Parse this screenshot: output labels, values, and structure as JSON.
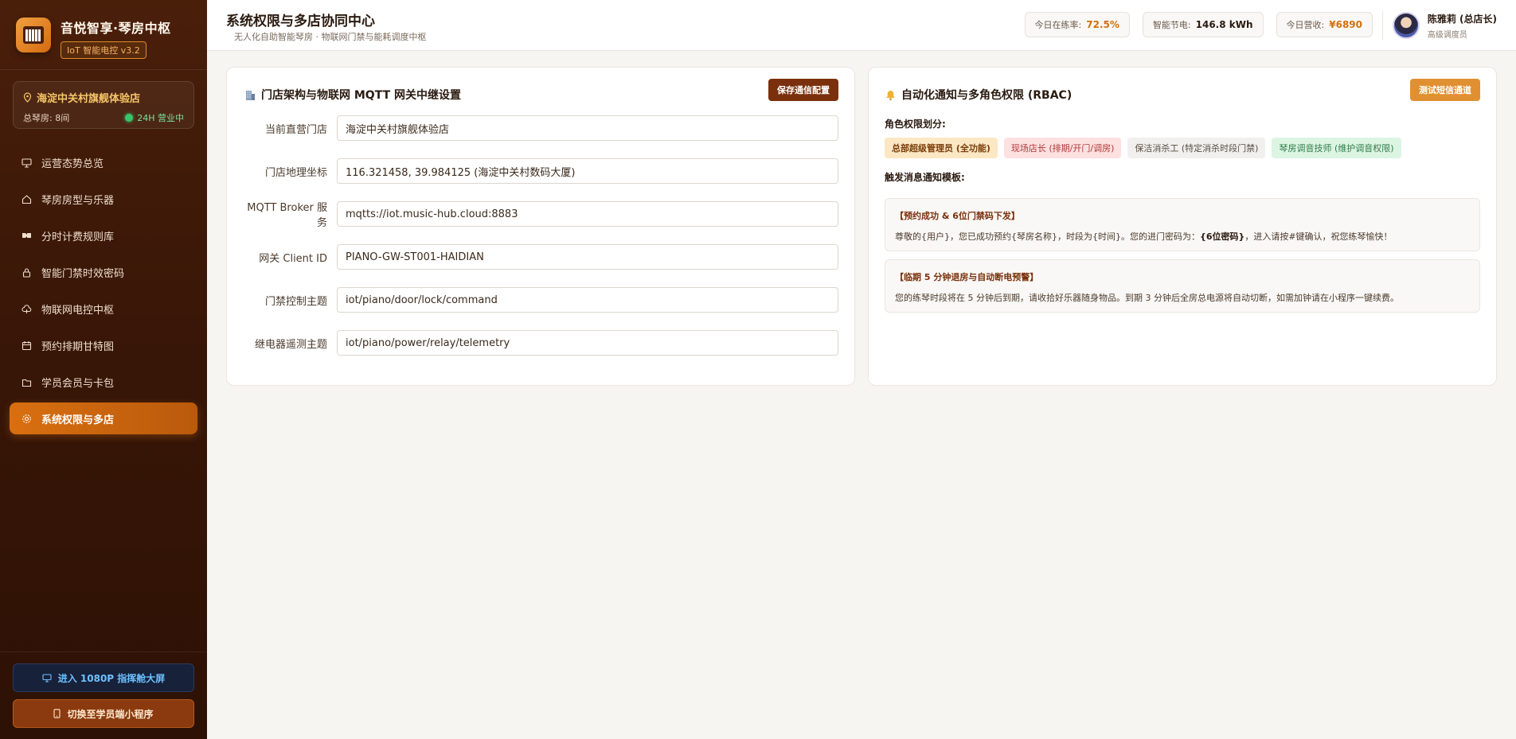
{
  "brand": {
    "title": "音悦智享·琴房中枢",
    "badge": "IoT 智能电控 v3.2"
  },
  "store": {
    "name": "海淀中关村旗舰体验店",
    "rooms": "总琴房: 8间",
    "status": "24H 营业中"
  },
  "nav": [
    {
      "label": "运营态势总览",
      "icon": "dashboard-icon"
    },
    {
      "label": "琴房房型与乐器",
      "icon": "home-icon"
    },
    {
      "label": "分时计费规则库",
      "icon": "pricing-icon"
    },
    {
      "label": "智能门禁时效密码",
      "icon": "lock-icon"
    },
    {
      "label": "物联网电控中枢",
      "icon": "cloud-icon"
    },
    {
      "label": "预约排期甘特图",
      "icon": "calendar-icon"
    },
    {
      "label": "学员会员与卡包",
      "icon": "wallet-icon"
    },
    {
      "label": "系统权限与多店",
      "icon": "gear-icon",
      "active": true
    }
  ],
  "footer": {
    "bigscreen": "进入 1080P 指挥舱大屏",
    "miniapp": "切换至学员端小程序"
  },
  "header": {
    "title": "系统权限与多店协同中心",
    "subtitle": "无人化自助智能琴房 · 物联网门禁与能耗调度中枢",
    "stats": [
      {
        "label": "今日在练率:",
        "value": "72.5%",
        "tone": "orange"
      },
      {
        "label": "智能节电:",
        "value": "146.8 kWh",
        "tone": "dark"
      },
      {
        "label": "今日营收:",
        "value": "¥6890",
        "tone": "orange"
      }
    ],
    "user": {
      "name": "陈雅莉 (总店长)",
      "role": "高级调度员"
    }
  },
  "mqtt": {
    "title": "门店架构与物联网 MQTT 网关中继设置",
    "save_label": "保存通信配置",
    "fields": [
      {
        "label": "当前直营门店",
        "value": "海淀中关村旗舰体验店"
      },
      {
        "label": "门店地理坐标",
        "value": "116.321458, 39.984125 (海淀中关村数码大厦)"
      },
      {
        "label": "MQTT Broker 服务",
        "value": "mqtts://iot.music-hub.cloud:8883"
      },
      {
        "label": "网关 Client ID",
        "value": "PIANO-GW-ST001-HAIDIAN"
      },
      {
        "label": "门禁控制主题",
        "value": "iot/piano/door/lock/command"
      },
      {
        "label": "继电器遥测主题",
        "value": "iot/piano/power/relay/telemetry"
      }
    ]
  },
  "rbac": {
    "title": "自动化通知与多角色权限 (RBAC)",
    "test_label": "测试短信通道",
    "roles_label": "角色权限划分:",
    "roles": [
      {
        "label": "总部超级管理员 (全功能)",
        "tone": "super"
      },
      {
        "label": "现场店长 (排期/开门/调房)",
        "tone": "manager"
      },
      {
        "label": "保洁消杀工 (特定消杀时段门禁)",
        "tone": "clean"
      },
      {
        "label": "琴房调音技师 (维护调音权限)",
        "tone": "tuner"
      }
    ],
    "templates_label": "触发消息通知模板:",
    "templates": [
      {
        "title": "【预约成功 & 6位门禁码下发】",
        "body_pre": "尊敬的{用户}，您已成功预约{琴房名称}，时段为{时间}。您的进门密码为：",
        "body_bold": "{6位密码}",
        "body_post": "，进入请按#键确认，祝您练琴愉快！"
      },
      {
        "title": "【临期 5 分钟退房与自动断电预警】",
        "body_pre": "您的练琴时段将在 5 分钟后到期，请收拾好乐器随身物品。到期 3 分钟后全房总电源将自动切断，如需加钟请在小程序一键续费。",
        "body_bold": "",
        "body_post": ""
      }
    ]
  }
}
